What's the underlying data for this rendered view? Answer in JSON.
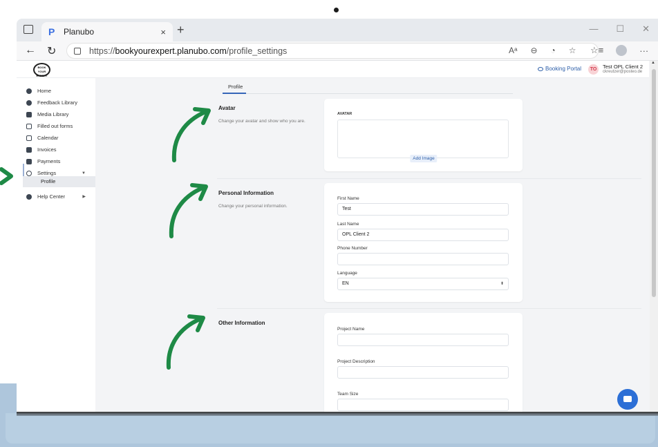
{
  "browser": {
    "tab_title": "Planubo",
    "tab_close": "×",
    "new_tab": "+",
    "url_host": "https://",
    "url_domain": "bookyourexpert.planubo.com",
    "url_path": "/profile_settings",
    "window_controls": [
      "—",
      "☐",
      "✕"
    ]
  },
  "header": {
    "logo_text": "BOOK YOUR EXPERT",
    "booking_portal": "Booking Portal",
    "user_initials": "TO",
    "user_name": "Test OPL Client 2",
    "user_email": "ckreutzer@posteo.de"
  },
  "sidebar": {
    "items": [
      {
        "label": "Home",
        "icon": "home-icon"
      },
      {
        "label": "Feedback Library",
        "icon": "chat-icon"
      },
      {
        "label": "Media Library",
        "icon": "library-icon"
      },
      {
        "label": "Filled out forms",
        "icon": "forms-icon"
      },
      {
        "label": "Calendar",
        "icon": "calendar-icon"
      },
      {
        "label": "Invoices",
        "icon": "invoice-icon"
      },
      {
        "label": "Payments",
        "icon": "card-icon"
      },
      {
        "label": "Settings",
        "icon": "gear-icon"
      },
      {
        "label": "Help Center",
        "icon": "help-icon"
      }
    ],
    "sub_item": "Profile"
  },
  "content": {
    "tab_label": "Profile",
    "avatar": {
      "title": "Avatar",
      "desc": "Change your avatar and show who you are.",
      "card_label": "AVATAR",
      "add_image": "Add Image"
    },
    "personal": {
      "title": "Personal Information",
      "desc": "Change your personal information.",
      "first_name_label": "First Name",
      "first_name_value": "Test",
      "last_name_label": "Last Name",
      "last_name_value": "OPL Client 2",
      "phone_label": "Phone Number",
      "phone_value": "",
      "language_label": "Language",
      "language_value": "EN"
    },
    "other": {
      "title": "Other Information",
      "project_name_label": "Project Name",
      "project_desc_label": "Project Description",
      "team_size_label": "Team Size"
    }
  },
  "colors": {
    "accent": "#2c5ea8",
    "arrow_green": "#1e8a46",
    "badge_bg": "#f8d3d6",
    "chat_button": "#2c6fd6"
  }
}
